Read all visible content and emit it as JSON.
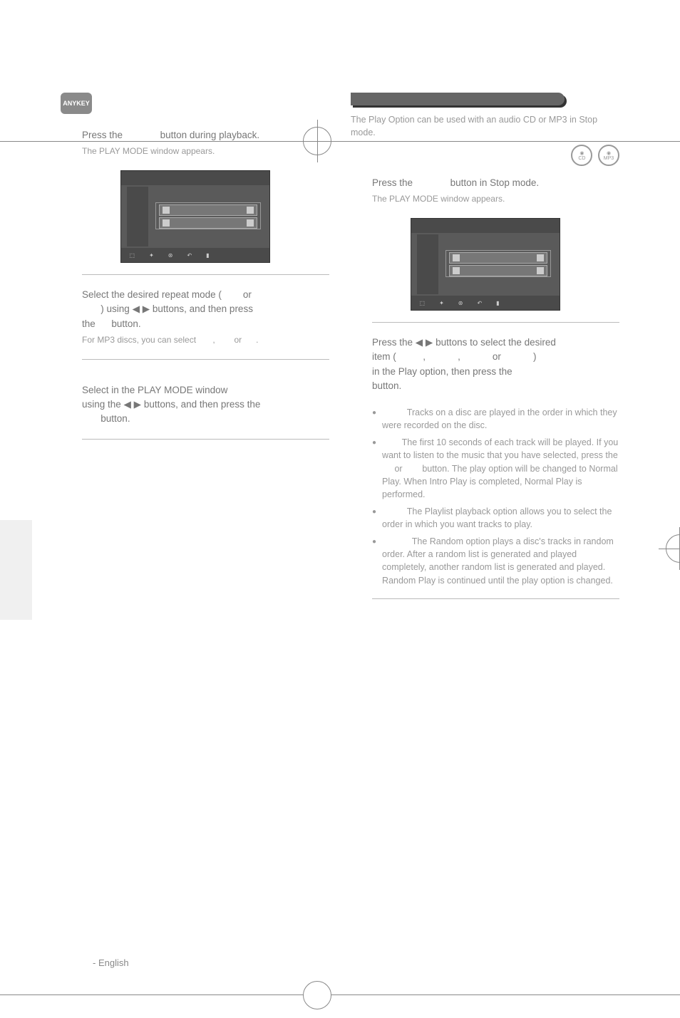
{
  "anykey_badge": "ANYKEY",
  "left": {
    "step1": {
      "prefix": "Press the ",
      "suffix": " button during playback.",
      "sub": "The PLAY MODE window appears."
    },
    "step2": {
      "line1a": "Select the desired repeat mode (",
      "line1b": " or",
      "line2a": ") using ",
      "arrows": "◀ ▶",
      "line2b": " buttons, and then press",
      "line3a": "the ",
      "line3b": " button.",
      "sub_a": "For MP3 discs, you can select ",
      "sub_b": ", ",
      "sub_c": " or ",
      "sub_d": "."
    },
    "step3": {
      "line1": "Select      in the PLAY MODE window",
      "line2a": "using the ",
      "arrows": "◀ ▶",
      "line2b": " buttons, and then press the",
      "line3": " button."
    }
  },
  "right": {
    "intro": "The Play Option can be used with an audio CD or MP3 in Stop mode.",
    "disc1": "CD",
    "disc2": "MP3",
    "step1": {
      "prefix": "Press the ",
      "suffix": " button in Stop mode.",
      "sub": "The PLAY MODE window appears."
    },
    "step2": {
      "line1a": "Press the ",
      "arrows": "◀ ▶",
      "line1b": " buttons to select the desired",
      "line2a": "item (",
      "sep1": ", ",
      "sep2": ", ",
      "sep3": " or ",
      "line2b": ")",
      "line3": "in the Play option, then press the ",
      "line4": "button."
    },
    "bullets": {
      "b1": "Tracks on a disc are played in the order in which they were recorded on the disc.",
      "b2a": "The first 10 seconds of each track will be played. If you want to listen to the music that you have selected, press the ",
      "b2b": " or ",
      "b2c": " button. The play option will be changed to Normal Play. When Intro Play is completed, Normal Play is performed.",
      "b3": "The Playlist playback option allows you to select the order in which you want tracks to play.",
      "b4": "The Random option plays a disc's tracks in random order. After a random list is generated and played completely, another random list is generated and played. Random Play is continued until the play option is changed."
    }
  },
  "footer": "- English"
}
